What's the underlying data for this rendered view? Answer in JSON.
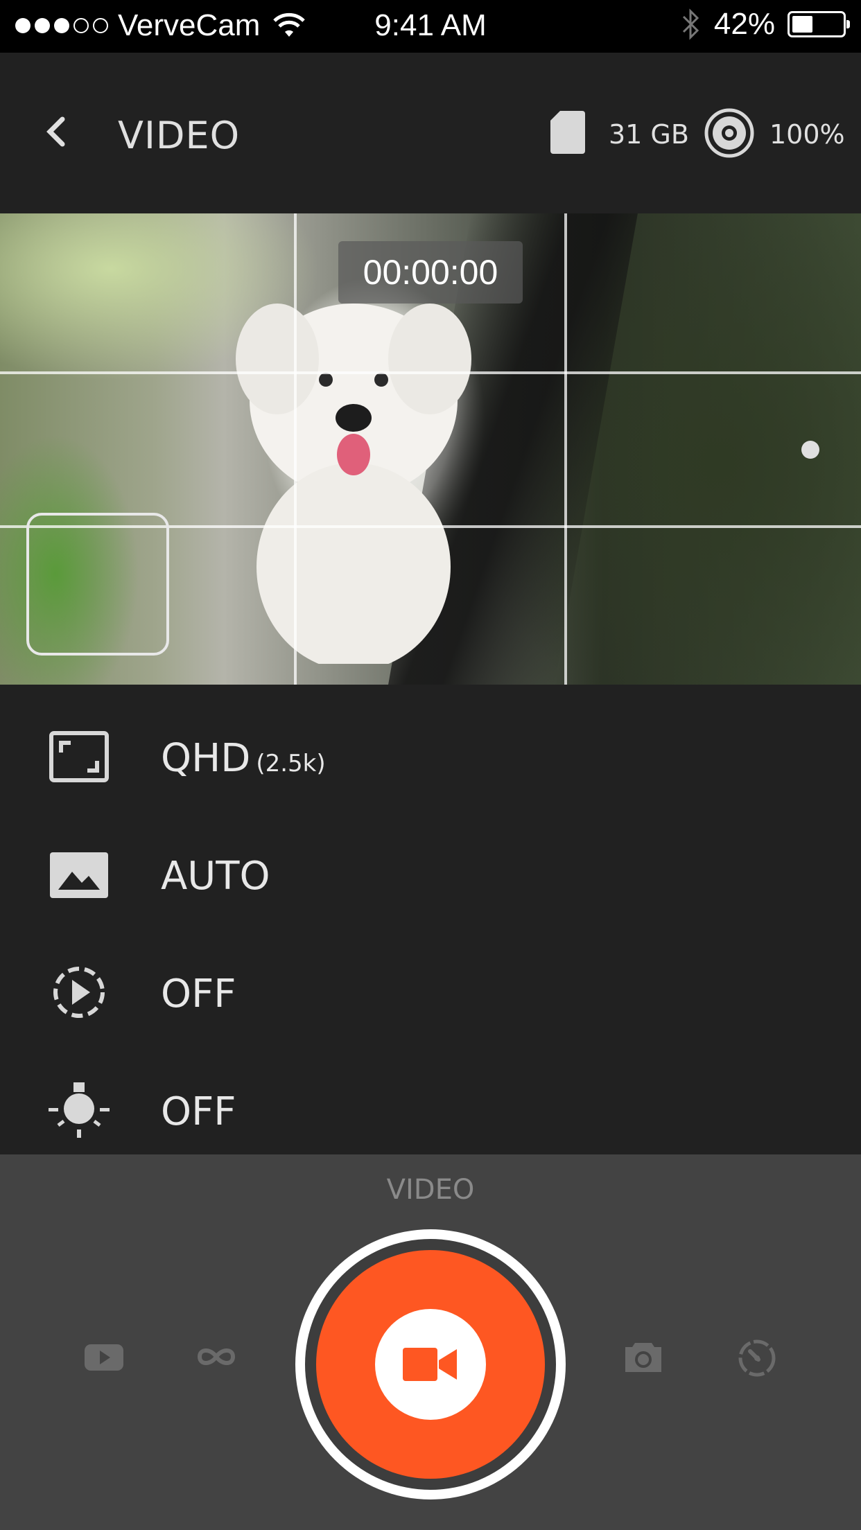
{
  "status_bar": {
    "carrier": "VerveCam",
    "time": "9:41 AM",
    "battery_percent": "42%",
    "battery_level": 0.42,
    "signal_bars_filled": 3,
    "signal_bars_total": 5,
    "icons": [
      "wifi-icon",
      "bluetooth-icon",
      "battery-icon"
    ]
  },
  "header": {
    "back_icon": "chevron-left-icon",
    "title": "VIDEO",
    "storage": {
      "icon": "sd-card-icon",
      "label": "31 GB"
    },
    "camera_battery": {
      "icon": "camera-battery-icon",
      "label": "100%"
    }
  },
  "viewfinder": {
    "timer": "00:00:00"
  },
  "settings": [
    {
      "icon": "resolution-icon",
      "label": "QHD",
      "sublabel": "(2.5k)"
    },
    {
      "icon": "image-icon",
      "label": "AUTO"
    },
    {
      "icon": "timelapse-icon",
      "label": "OFF"
    },
    {
      "icon": "light-icon",
      "label": "OFF"
    }
  ],
  "mode_bar": {
    "current_mode": "VIDEO",
    "modes": [
      "youtube-icon",
      "loop-icon",
      "video-record-icon",
      "camera-icon",
      "timer-icon"
    ]
  },
  "colors": {
    "accent": "#fe5722",
    "header_bg": "#212121",
    "panel_bg": "#434343"
  }
}
